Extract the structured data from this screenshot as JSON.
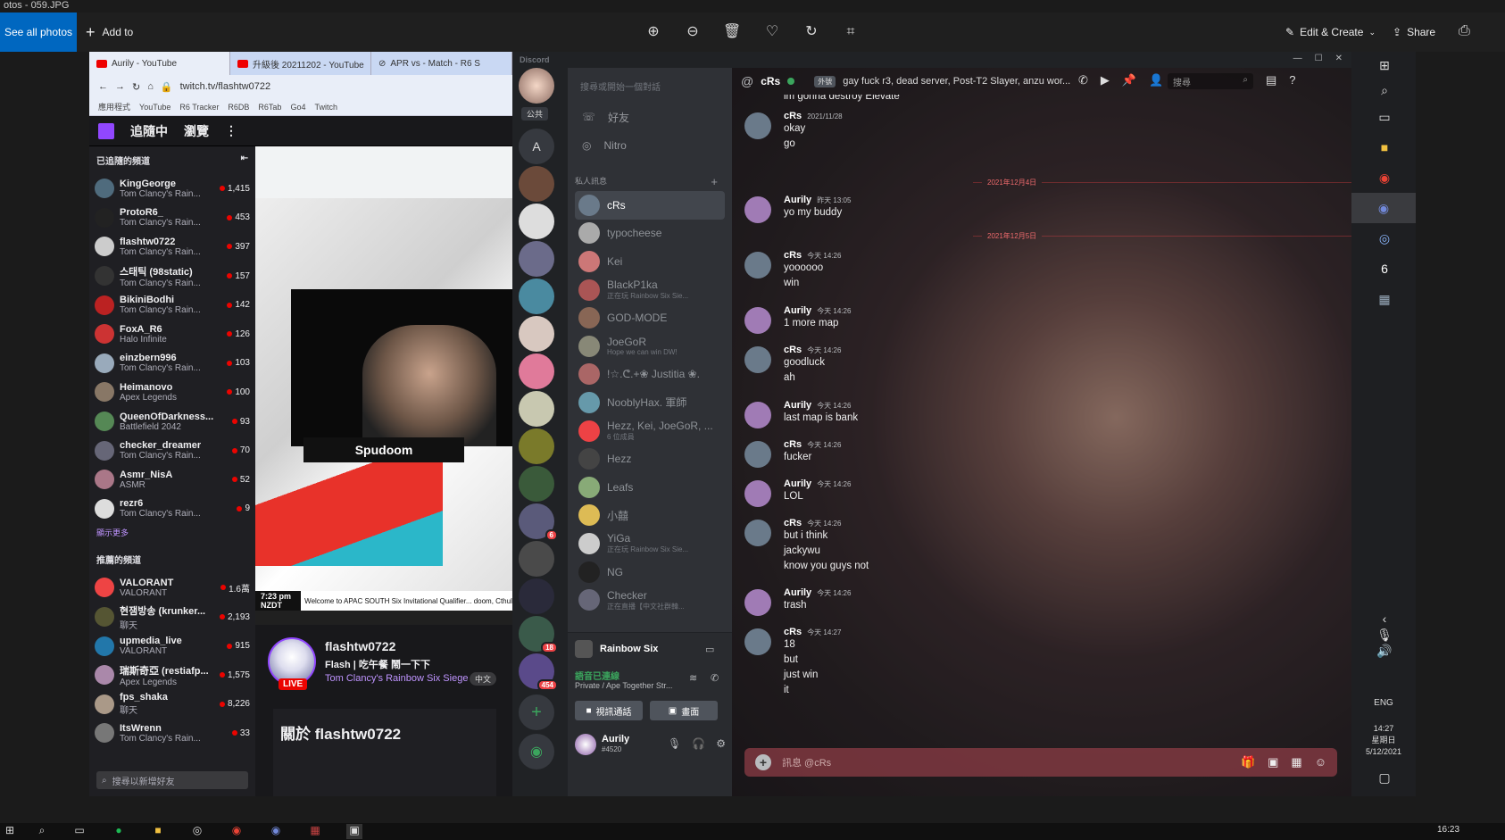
{
  "photos": {
    "title": "otos - 059.JPG",
    "see_all": "See all photos",
    "add_to": "Add to",
    "edit_create": "Edit & Create",
    "share": "Share"
  },
  "chrome": {
    "tabs": [
      {
        "label": "Aurily - YouTube"
      },
      {
        "label": "升級後 20211202 - YouTube"
      },
      {
        "label": "APR vs - Match - R6 S"
      }
    ],
    "url": "twitch.tv/flashtw0722",
    "bookmarks": [
      "應用程式",
      "YouTube",
      "R6 Tracker",
      "R6DB",
      "R6Tab",
      "Go4",
      "Twitch"
    ]
  },
  "twitch": {
    "nav": {
      "following": "追隨中",
      "browse": "瀏覽"
    },
    "followed_header": "已追隨的頻道",
    "followed": [
      {
        "name": "KingGeorge",
        "game": "Tom Clancy's Rain...",
        "viewers": "1,415",
        "color": "#4f6b7d"
      },
      {
        "name": "ProtoR6_",
        "game": "Tom Clancy's Rain...",
        "viewers": "453",
        "color": "#222"
      },
      {
        "name": "flashtw0722",
        "game": "Tom Clancy's Rain...",
        "viewers": "397",
        "color": "#ccc"
      },
      {
        "name": "스태틱 (98static)",
        "game": "Tom Clancy's Rain...",
        "viewers": "157",
        "color": "#333"
      },
      {
        "name": "BikiniBodhi",
        "game": "Tom Clancy's Rain...",
        "viewers": "142",
        "color": "#b22"
      },
      {
        "name": "FoxA_R6",
        "game": "Halo Infinite",
        "viewers": "126",
        "color": "#c33"
      },
      {
        "name": "einzbern996",
        "game": "Tom Clancy's Rain...",
        "viewers": "103",
        "color": "#9ab"
      },
      {
        "name": "Heimanovo",
        "game": "Apex Legends",
        "viewers": "100",
        "color": "#876"
      },
      {
        "name": "QueenOfDarkness...",
        "game": "Battlefield 2042",
        "viewers": "93",
        "color": "#585"
      },
      {
        "name": "checker_dreamer",
        "game": "Tom Clancy's Rain...",
        "viewers": "70",
        "color": "#667"
      },
      {
        "name": "Asmr_NisA",
        "game": "ASMR",
        "viewers": "52",
        "color": "#a78"
      },
      {
        "name": "rezr6",
        "game": "Tom Clancy's Rain...",
        "viewers": "9",
        "color": "#ddd"
      }
    ],
    "show_more": "顯示更多",
    "recommended_header": "推薦的頻道",
    "recommended": [
      {
        "name": "VALORANT",
        "game": "VALORANT",
        "viewers": "1.6萬",
        "color": "#e44"
      },
      {
        "name": "현잼방송 (krunker...",
        "game": "聊天",
        "viewers": "2,193",
        "color": "#553"
      },
      {
        "name": "upmedia_live",
        "game": "VALORANT",
        "viewers": "915",
        "color": "#27a"
      },
      {
        "name": "瑞斯奇亞 (restiafp...",
        "game": "Apex Legends",
        "viewers": "1,575",
        "color": "#a8a"
      },
      {
        "name": "fps_shaka",
        "game": "聊天",
        "viewers": "8,226",
        "color": "#a98"
      },
      {
        "name": "ItsWrenn",
        "game": "Tom Clancy's Rain...",
        "viewers": "33",
        "color": "#777"
      }
    ],
    "search_placeholder": "搜尋以新增好友",
    "overlay_name": "Spudoom",
    "ticker_time": "7:23 pm NZDT",
    "ticker_text": "Welcome to APAC SOUTH Six Invitational Qualifier... doom, Cthulhu and Proto, make sure to keep up",
    "streamer": "flashtw0722",
    "stream_title": "Flash | 吃午餐 鬧一下下",
    "stream_game": "Tom Clancy's Rainbow Six Siege",
    "lang": "中文",
    "live": "LIVE",
    "about": "關於 flashtw0722"
  },
  "discord": {
    "brand": "Discord",
    "search_placeholder": "搜尋或開始一個對話",
    "public_label": "公共",
    "nav": [
      {
        "label": "好友"
      },
      {
        "label": "Nitro"
      }
    ],
    "dm_header": "私人訊息",
    "dms": [
      {
        "name": "cRs",
        "status": "",
        "color": "#6a7a8a"
      },
      {
        "name": "typocheese",
        "status": "",
        "color": "#aaa"
      },
      {
        "name": "Kei",
        "status": "",
        "color": "#c77"
      },
      {
        "name": "BlackP1ka",
        "status": "正在玩 Rainbow Six Sie...",
        "color": "#a55"
      },
      {
        "name": "GOD-MODE",
        "status": "",
        "color": "#865"
      },
      {
        "name": "JoeGoR",
        "status": "Hope we can win DW!",
        "color": "#887"
      },
      {
        "name": "!☆.ᕦ.+❀ Justitia ❀.",
        "status": "",
        "color": "#a66"
      },
      {
        "name": "NooblyHax. 軍師",
        "status": "",
        "color": "#69a"
      },
      {
        "name": "Hezz, Kei, JoeGoR, ...",
        "status": "6 位成員",
        "color": "#ed4245"
      },
      {
        "name": "Hezz",
        "status": "",
        "color": "#444"
      },
      {
        "name": "Leafs",
        "status": "",
        "color": "#8a7"
      },
      {
        "name": "小囍",
        "status": "",
        "color": "#db5"
      },
      {
        "name": "YiGa",
        "status": "正在玩 Rainbow Six Sie...",
        "color": "#ccc"
      },
      {
        "name": "NG",
        "status": "",
        "color": "#222"
      },
      {
        "name": "Checker",
        "status": "正在直播【中文社群韓...",
        "color": "#667"
      }
    ],
    "voice": {
      "server": "Rainbow Six",
      "connected": "語音已連線",
      "channel": "Private / Ape Together Str...",
      "video_btn": "視訊通話",
      "screen_btn": "畫面"
    },
    "user": {
      "name": "Aurily",
      "tag": "#4520"
    },
    "server_badges": [
      "6",
      "18",
      "454"
    ],
    "chat": {
      "recipient": "cRs",
      "tag": "外號",
      "status": "gay fuck r3, dead server, Post-T2 Slayer, anzu wor...",
      "search_placeholder": "搜尋",
      "top_line": "im gonna destroy Elevate",
      "dividers": [
        "2021年12月4日",
        "2021年12月5日"
      ],
      "messages": [
        {
          "author": "cRs",
          "time": "2021/11/28",
          "lines": [
            "okay",
            "go"
          ],
          "color": "#6a7a8a"
        },
        {
          "author": "Aurily",
          "time": "昨天 13:05",
          "lines": [
            "yo my buddy"
          ],
          "color": "#a07bb5"
        },
        {
          "author": "cRs",
          "time": "今天 14:26",
          "lines": [
            "yoooooo",
            "win"
          ],
          "color": "#6a7a8a"
        },
        {
          "author": "Aurily",
          "time": "今天 14:26",
          "lines": [
            "1 more map"
          ],
          "color": "#a07bb5"
        },
        {
          "author": "cRs",
          "time": "今天 14:26",
          "lines": [
            "goodluck",
            "ah"
          ],
          "color": "#6a7a8a"
        },
        {
          "author": "Aurily",
          "time": "今天 14:26",
          "lines": [
            "last map is bank"
          ],
          "color": "#a07bb5"
        },
        {
          "author": "cRs",
          "time": "今天 14:26",
          "lines": [
            "fucker"
          ],
          "color": "#6a7a8a"
        },
        {
          "author": "Aurily",
          "time": "今天 14:26",
          "lines": [
            "LOL"
          ],
          "color": "#a07bb5"
        },
        {
          "author": "cRs",
          "time": "今天 14:26",
          "lines": [
            "but i think",
            "jackywu",
            "know you guys not"
          ],
          "color": "#6a7a8a"
        },
        {
          "author": "Aurily",
          "time": "今天 14:26",
          "lines": [
            "trash"
          ],
          "color": "#a07bb5"
        },
        {
          "author": "cRs",
          "time": "今天 14:27",
          "lines": [
            "18",
            "but",
            "just win",
            "it"
          ],
          "color": "#6a7a8a"
        }
      ],
      "input_placeholder": "訊息 @cRs"
    }
  },
  "windows": {
    "lang": "ENG",
    "clock": "14:27",
    "weekday": "星期日",
    "date": "5/12/2021",
    "taskbar_time": "16:23"
  }
}
